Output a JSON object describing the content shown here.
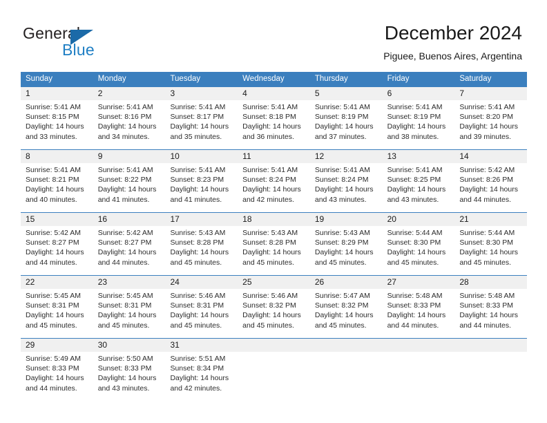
{
  "logo": {
    "word_one": "General",
    "word_two": "Blue",
    "triangle": "triangle-mark"
  },
  "header": {
    "title": "December 2024",
    "subtitle": "Piguee, Buenos Aires, Argentina"
  },
  "colors": {
    "header_blue": "#3b7fbe",
    "daynum_band": "#f0f0f0",
    "logo_blue": "#1f7fc4",
    "text": "#1a1a1a"
  },
  "weekdays": [
    "Sunday",
    "Monday",
    "Tuesday",
    "Wednesday",
    "Thursday",
    "Friday",
    "Saturday"
  ],
  "weeks": [
    [
      {
        "day": "1",
        "sunrise": "Sunrise: 5:41 AM",
        "sunset": "Sunset: 8:15 PM",
        "daylight1": "Daylight: 14 hours",
        "daylight2": "and 33 minutes."
      },
      {
        "day": "2",
        "sunrise": "Sunrise: 5:41 AM",
        "sunset": "Sunset: 8:16 PM",
        "daylight1": "Daylight: 14 hours",
        "daylight2": "and 34 minutes."
      },
      {
        "day": "3",
        "sunrise": "Sunrise: 5:41 AM",
        "sunset": "Sunset: 8:17 PM",
        "daylight1": "Daylight: 14 hours",
        "daylight2": "and 35 minutes."
      },
      {
        "day": "4",
        "sunrise": "Sunrise: 5:41 AM",
        "sunset": "Sunset: 8:18 PM",
        "daylight1": "Daylight: 14 hours",
        "daylight2": "and 36 minutes."
      },
      {
        "day": "5",
        "sunrise": "Sunrise: 5:41 AM",
        "sunset": "Sunset: 8:19 PM",
        "daylight1": "Daylight: 14 hours",
        "daylight2": "and 37 minutes."
      },
      {
        "day": "6",
        "sunrise": "Sunrise: 5:41 AM",
        "sunset": "Sunset: 8:19 PM",
        "daylight1": "Daylight: 14 hours",
        "daylight2": "and 38 minutes."
      },
      {
        "day": "7",
        "sunrise": "Sunrise: 5:41 AM",
        "sunset": "Sunset: 8:20 PM",
        "daylight1": "Daylight: 14 hours",
        "daylight2": "and 39 minutes."
      }
    ],
    [
      {
        "day": "8",
        "sunrise": "Sunrise: 5:41 AM",
        "sunset": "Sunset: 8:21 PM",
        "daylight1": "Daylight: 14 hours",
        "daylight2": "and 40 minutes."
      },
      {
        "day": "9",
        "sunrise": "Sunrise: 5:41 AM",
        "sunset": "Sunset: 8:22 PM",
        "daylight1": "Daylight: 14 hours",
        "daylight2": "and 41 minutes."
      },
      {
        "day": "10",
        "sunrise": "Sunrise: 5:41 AM",
        "sunset": "Sunset: 8:23 PM",
        "daylight1": "Daylight: 14 hours",
        "daylight2": "and 41 minutes."
      },
      {
        "day": "11",
        "sunrise": "Sunrise: 5:41 AM",
        "sunset": "Sunset: 8:24 PM",
        "daylight1": "Daylight: 14 hours",
        "daylight2": "and 42 minutes."
      },
      {
        "day": "12",
        "sunrise": "Sunrise: 5:41 AM",
        "sunset": "Sunset: 8:24 PM",
        "daylight1": "Daylight: 14 hours",
        "daylight2": "and 43 minutes."
      },
      {
        "day": "13",
        "sunrise": "Sunrise: 5:41 AM",
        "sunset": "Sunset: 8:25 PM",
        "daylight1": "Daylight: 14 hours",
        "daylight2": "and 43 minutes."
      },
      {
        "day": "14",
        "sunrise": "Sunrise: 5:42 AM",
        "sunset": "Sunset: 8:26 PM",
        "daylight1": "Daylight: 14 hours",
        "daylight2": "and 44 minutes."
      }
    ],
    [
      {
        "day": "15",
        "sunrise": "Sunrise: 5:42 AM",
        "sunset": "Sunset: 8:27 PM",
        "daylight1": "Daylight: 14 hours",
        "daylight2": "and 44 minutes."
      },
      {
        "day": "16",
        "sunrise": "Sunrise: 5:42 AM",
        "sunset": "Sunset: 8:27 PM",
        "daylight1": "Daylight: 14 hours",
        "daylight2": "and 44 minutes."
      },
      {
        "day": "17",
        "sunrise": "Sunrise: 5:43 AM",
        "sunset": "Sunset: 8:28 PM",
        "daylight1": "Daylight: 14 hours",
        "daylight2": "and 45 minutes."
      },
      {
        "day": "18",
        "sunrise": "Sunrise: 5:43 AM",
        "sunset": "Sunset: 8:28 PM",
        "daylight1": "Daylight: 14 hours",
        "daylight2": "and 45 minutes."
      },
      {
        "day": "19",
        "sunrise": "Sunrise: 5:43 AM",
        "sunset": "Sunset: 8:29 PM",
        "daylight1": "Daylight: 14 hours",
        "daylight2": "and 45 minutes."
      },
      {
        "day": "20",
        "sunrise": "Sunrise: 5:44 AM",
        "sunset": "Sunset: 8:30 PM",
        "daylight1": "Daylight: 14 hours",
        "daylight2": "and 45 minutes."
      },
      {
        "day": "21",
        "sunrise": "Sunrise: 5:44 AM",
        "sunset": "Sunset: 8:30 PM",
        "daylight1": "Daylight: 14 hours",
        "daylight2": "and 45 minutes."
      }
    ],
    [
      {
        "day": "22",
        "sunrise": "Sunrise: 5:45 AM",
        "sunset": "Sunset: 8:31 PM",
        "daylight1": "Daylight: 14 hours",
        "daylight2": "and 45 minutes."
      },
      {
        "day": "23",
        "sunrise": "Sunrise: 5:45 AM",
        "sunset": "Sunset: 8:31 PM",
        "daylight1": "Daylight: 14 hours",
        "daylight2": "and 45 minutes."
      },
      {
        "day": "24",
        "sunrise": "Sunrise: 5:46 AM",
        "sunset": "Sunset: 8:31 PM",
        "daylight1": "Daylight: 14 hours",
        "daylight2": "and 45 minutes."
      },
      {
        "day": "25",
        "sunrise": "Sunrise: 5:46 AM",
        "sunset": "Sunset: 8:32 PM",
        "daylight1": "Daylight: 14 hours",
        "daylight2": "and 45 minutes."
      },
      {
        "day": "26",
        "sunrise": "Sunrise: 5:47 AM",
        "sunset": "Sunset: 8:32 PM",
        "daylight1": "Daylight: 14 hours",
        "daylight2": "and 45 minutes."
      },
      {
        "day": "27",
        "sunrise": "Sunrise: 5:48 AM",
        "sunset": "Sunset: 8:33 PM",
        "daylight1": "Daylight: 14 hours",
        "daylight2": "and 44 minutes."
      },
      {
        "day": "28",
        "sunrise": "Sunrise: 5:48 AM",
        "sunset": "Sunset: 8:33 PM",
        "daylight1": "Daylight: 14 hours",
        "daylight2": "and 44 minutes."
      }
    ],
    [
      {
        "day": "29",
        "sunrise": "Sunrise: 5:49 AM",
        "sunset": "Sunset: 8:33 PM",
        "daylight1": "Daylight: 14 hours",
        "daylight2": "and 44 minutes."
      },
      {
        "day": "30",
        "sunrise": "Sunrise: 5:50 AM",
        "sunset": "Sunset: 8:33 PM",
        "daylight1": "Daylight: 14 hours",
        "daylight2": "and 43 minutes."
      },
      {
        "day": "31",
        "sunrise": "Sunrise: 5:51 AM",
        "sunset": "Sunset: 8:34 PM",
        "daylight1": "Daylight: 14 hours",
        "daylight2": "and 42 minutes."
      },
      {
        "day": "",
        "sunrise": "",
        "sunset": "",
        "daylight1": "",
        "daylight2": ""
      },
      {
        "day": "",
        "sunrise": "",
        "sunset": "",
        "daylight1": "",
        "daylight2": ""
      },
      {
        "day": "",
        "sunrise": "",
        "sunset": "",
        "daylight1": "",
        "daylight2": ""
      },
      {
        "day": "",
        "sunrise": "",
        "sunset": "",
        "daylight1": "",
        "daylight2": ""
      }
    ]
  ]
}
